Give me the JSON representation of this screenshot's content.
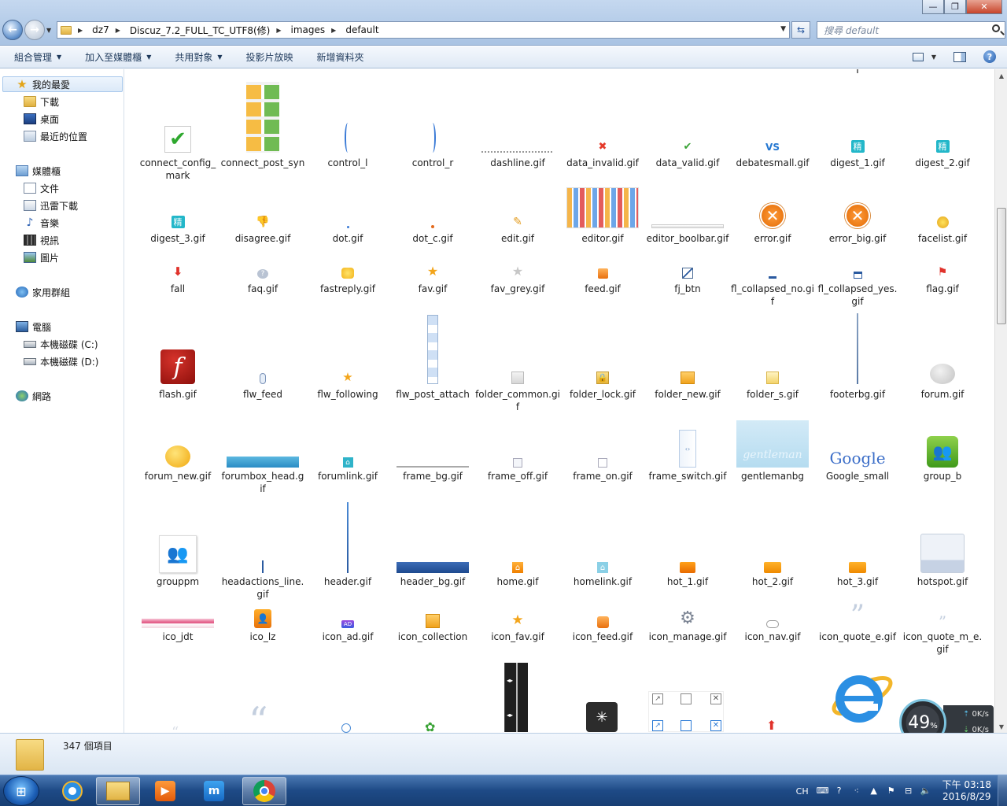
{
  "window": {
    "minimize": "—",
    "maximize": "❐",
    "close": "✕"
  },
  "address": {
    "crumbs": [
      "dz7",
      "Discuz_7.2_FULL_TC_UTF8(修)",
      "images",
      "default"
    ],
    "search_placeholder": "搜尋 default"
  },
  "toolbar": {
    "organize": "組合管理",
    "add_to_library": "加入至媒體櫃",
    "share_with": "共用對象",
    "slideshow": "投影片放映",
    "new_folder": "新增資料夾"
  },
  "nav": {
    "favorites": "我的最愛",
    "downloads": "下載",
    "desktop": "桌面",
    "recent": "最近的位置",
    "libraries": "媒體櫃",
    "documents": "文件",
    "thunder": "迅雷下載",
    "music": "音樂",
    "videos": "視訊",
    "pictures": "圖片",
    "homegroup": "家用群組",
    "computer": "電腦",
    "drive_c": "本機磁碟 (C:)",
    "drive_d": "本機磁碟 (D:)",
    "network": "網路"
  },
  "files": [
    [
      "connect_config_mark",
      "connect_post_syn",
      "control_l",
      "control_r",
      "dashline.gif",
      "data_invalid.gif",
      "data_valid.gif",
      "debatesmall.gif",
      "digest_1.gif",
      "digest_2.gif"
    ],
    [
      "digest_3.gif",
      "disagree.gif",
      "dot.gif",
      "dot_c.gif",
      "edit.gif",
      "editor.gif",
      "editor_boolbar.gif",
      "error.gif",
      "error_big.gif",
      "facelist.gif"
    ],
    [
      "fall",
      "faq.gif",
      "fastreply.gif",
      "fav.gif",
      "fav_grey.gif",
      "feed.gif",
      "fj_btn",
      "fl_collapsed_no.gif",
      "fl_collapsed_yes.gif",
      "flag.gif"
    ],
    [
      "flash.gif",
      "flw_feed",
      "flw_following",
      "flw_post_attach",
      "folder_common.gif",
      "folder_lock.gif",
      "folder_new.gif",
      "folder_s.gif",
      "footerbg.gif",
      "forum.gif"
    ],
    [
      "forum_new.gif",
      "forumbox_head.gif",
      "forumlink.gif",
      "frame_bg.gif",
      "frame_off.gif",
      "frame_on.gif",
      "frame_switch.gif",
      "gentlemanbg",
      "Google_small",
      "group_b"
    ],
    [
      "grouppm",
      "headactions_line.gif",
      "header.gif",
      "header_bg.gif",
      "home.gif",
      "homelink.gif",
      "hot_1.gif",
      "hot_2.gif",
      "hot_3.gif",
      "hotspot.gif"
    ],
    [
      "ico_jdt",
      "ico_lz",
      "icon_ad.gif",
      "icon_collection",
      "icon_fav.gif",
      "icon_feed.gif",
      "icon_manage.gif",
      "icon_nav.gif",
      "icon_quote_e.gif",
      "icon_quote_m_e.gif"
    ]
  ],
  "thumb_text": {
    "debate": "VS",
    "digest": "精",
    "flash": "f",
    "google": "Google",
    "gentleman": "gentleman",
    "ad": "AD"
  },
  "status": {
    "item_count": "347 個項目"
  },
  "tray": {
    "lang": "CH",
    "time": "下午 03:18",
    "date": "2016/8/29"
  },
  "speed": {
    "percent": "49",
    "unit": "%",
    "up": "0K/s",
    "down": "0K/s"
  }
}
